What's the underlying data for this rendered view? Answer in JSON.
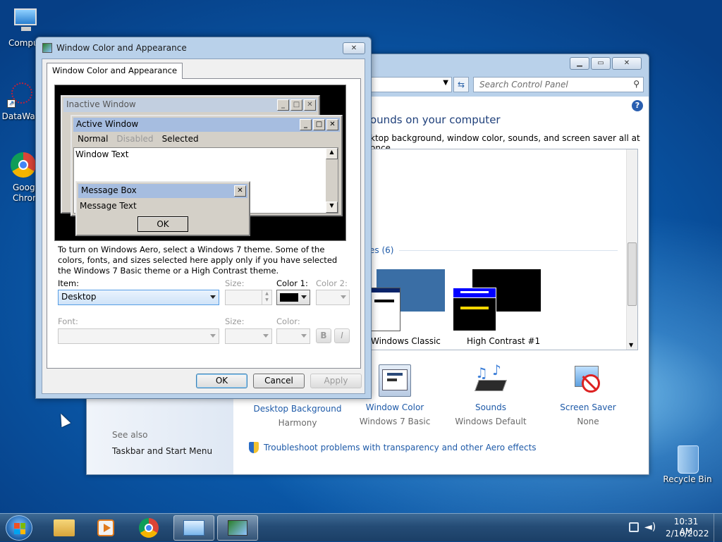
{
  "desktop": {
    "icons": [
      {
        "label": "Compu"
      },
      {
        "label": "DataWag"
      },
      {
        "label": "Googl Chron"
      },
      {
        "label": "Recycle Bin"
      }
    ]
  },
  "control_panel": {
    "search_placeholder": "Search Control Panel",
    "heading": "ounds on your computer",
    "subheading": "ktop background, window color, sounds, and screen saver all at once.",
    "group_label": "es (6)",
    "themes": [
      {
        "label": "Windows Classic"
      },
      {
        "label": "High Contrast #1"
      }
    ],
    "bottom_items": [
      {
        "title": "Desktop Background",
        "value": "Harmony"
      },
      {
        "title": "Window Color",
        "value": "Windows 7 Basic"
      },
      {
        "title": "Sounds",
        "value": "Windows Default"
      },
      {
        "title": "Screen Saver",
        "value": "None"
      }
    ],
    "see_also": "See also",
    "see_also_link": "Taskbar and Start Menu",
    "troubleshoot": "Troubleshoot problems with transparency and other Aero effects"
  },
  "dialog": {
    "title": "Window Color and Appearance",
    "tab": "Window Color and Appearance",
    "preview": {
      "inactive_title": "Inactive Window",
      "active_title": "Active Window",
      "menu": [
        "Normal",
        "Disabled",
        "Selected"
      ],
      "window_text": "Window Text",
      "msgbox_title": "Message Box",
      "msgbox_text": "Message Text",
      "ok": "OK"
    },
    "info": "To turn on Windows Aero, select a Windows 7 theme.  Some of the colors, fonts, and sizes selected here apply only if you have selected the Windows 7 Basic theme or a High Contrast theme.",
    "item_label": "Item:",
    "item_value": "Desktop",
    "size_label": "Size:",
    "color1_label": "Color 1:",
    "color2_label": "Color 2:",
    "font_label": "Font:",
    "font_size_label": "Size:",
    "font_color_label": "Color:",
    "bold": "B",
    "italic": "I",
    "buttons": {
      "ok": "OK",
      "cancel": "Cancel",
      "apply": "Apply"
    }
  },
  "taskbar": {
    "time": "10:31 AM",
    "date": "2/16/2022"
  },
  "colors": {
    "link": "#1e5aa8",
    "classic_blue": "#3a6ea5",
    "hc_black": "#000000",
    "inactive_caption": "#c2cfe0",
    "active_caption": "#a6bde0"
  }
}
